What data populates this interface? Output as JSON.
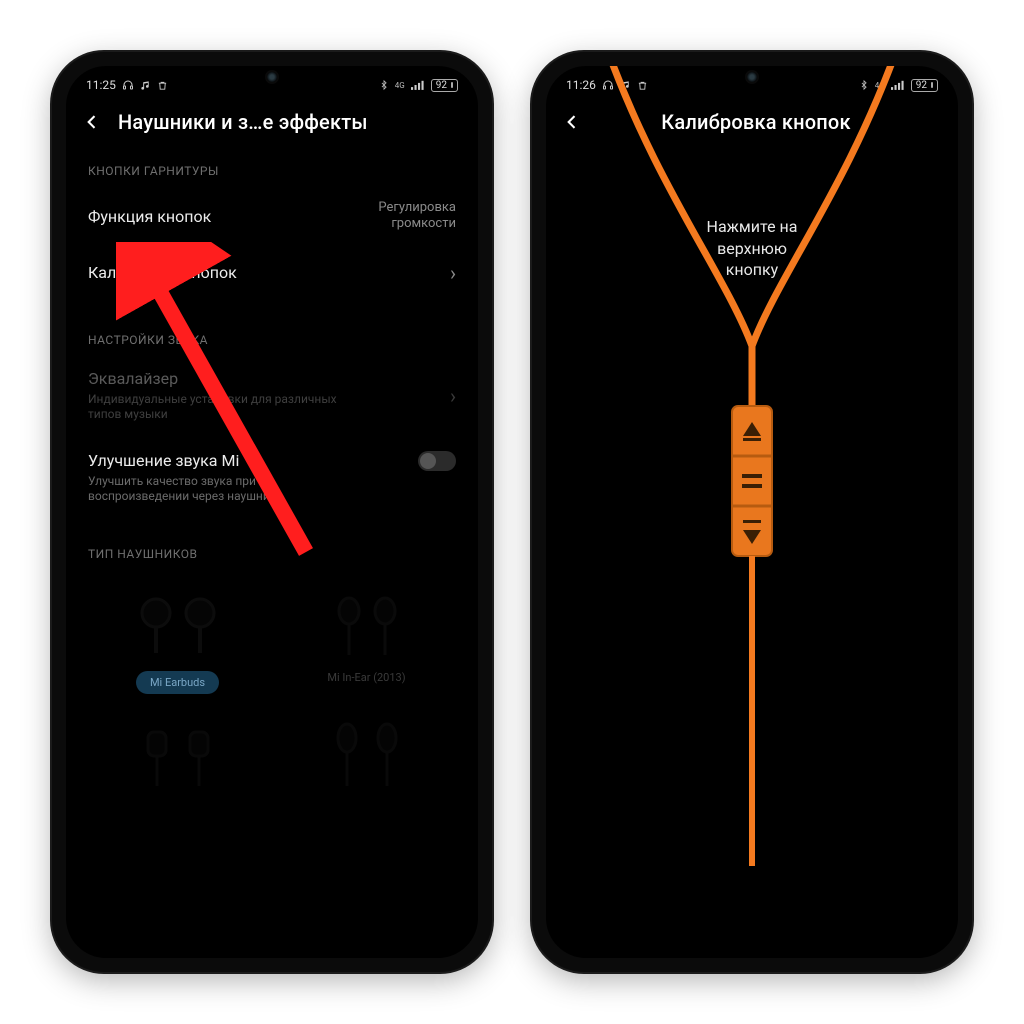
{
  "colors": {
    "accent_orange": "#f47a1f",
    "arrow_red": "#ff1e1e"
  },
  "phone1": {
    "status": {
      "time": "11:25",
      "battery": "92"
    },
    "title": "Наушники и з…е эффекты",
    "sections": {
      "headset": {
        "label": "КНОПКИ ГАРНИТУРЫ",
        "button_function": {
          "label": "Функция кнопок",
          "value_line1": "Регулировка",
          "value_line2": "громкости"
        },
        "calibration": {
          "label": "Калибровка кнопок"
        }
      },
      "sound": {
        "label": "НАСТРОЙКИ ЗВУКА",
        "equalizer": {
          "label": "Эквалайзер",
          "sub": "Индивидуальные установки для различных типов музыки"
        },
        "enhance": {
          "label": "Улучшение звука Mi",
          "sub": "Улучшить качество звука при воспроизведении через наушники"
        }
      },
      "type": {
        "label": "ТИП НАУШНИКОВ",
        "items": [
          {
            "name": "Mi Earbuds"
          },
          {
            "name": "Mi In-Ear (2013)"
          },
          {
            "name": ""
          },
          {
            "name": ""
          }
        ]
      }
    }
  },
  "phone2": {
    "status": {
      "time": "11:26",
      "battery": "92"
    },
    "title": "Калибровка кнопок",
    "instruction_line1": "Нажмите на",
    "instruction_line2": "верхнюю",
    "instruction_line3": "кнопку"
  }
}
